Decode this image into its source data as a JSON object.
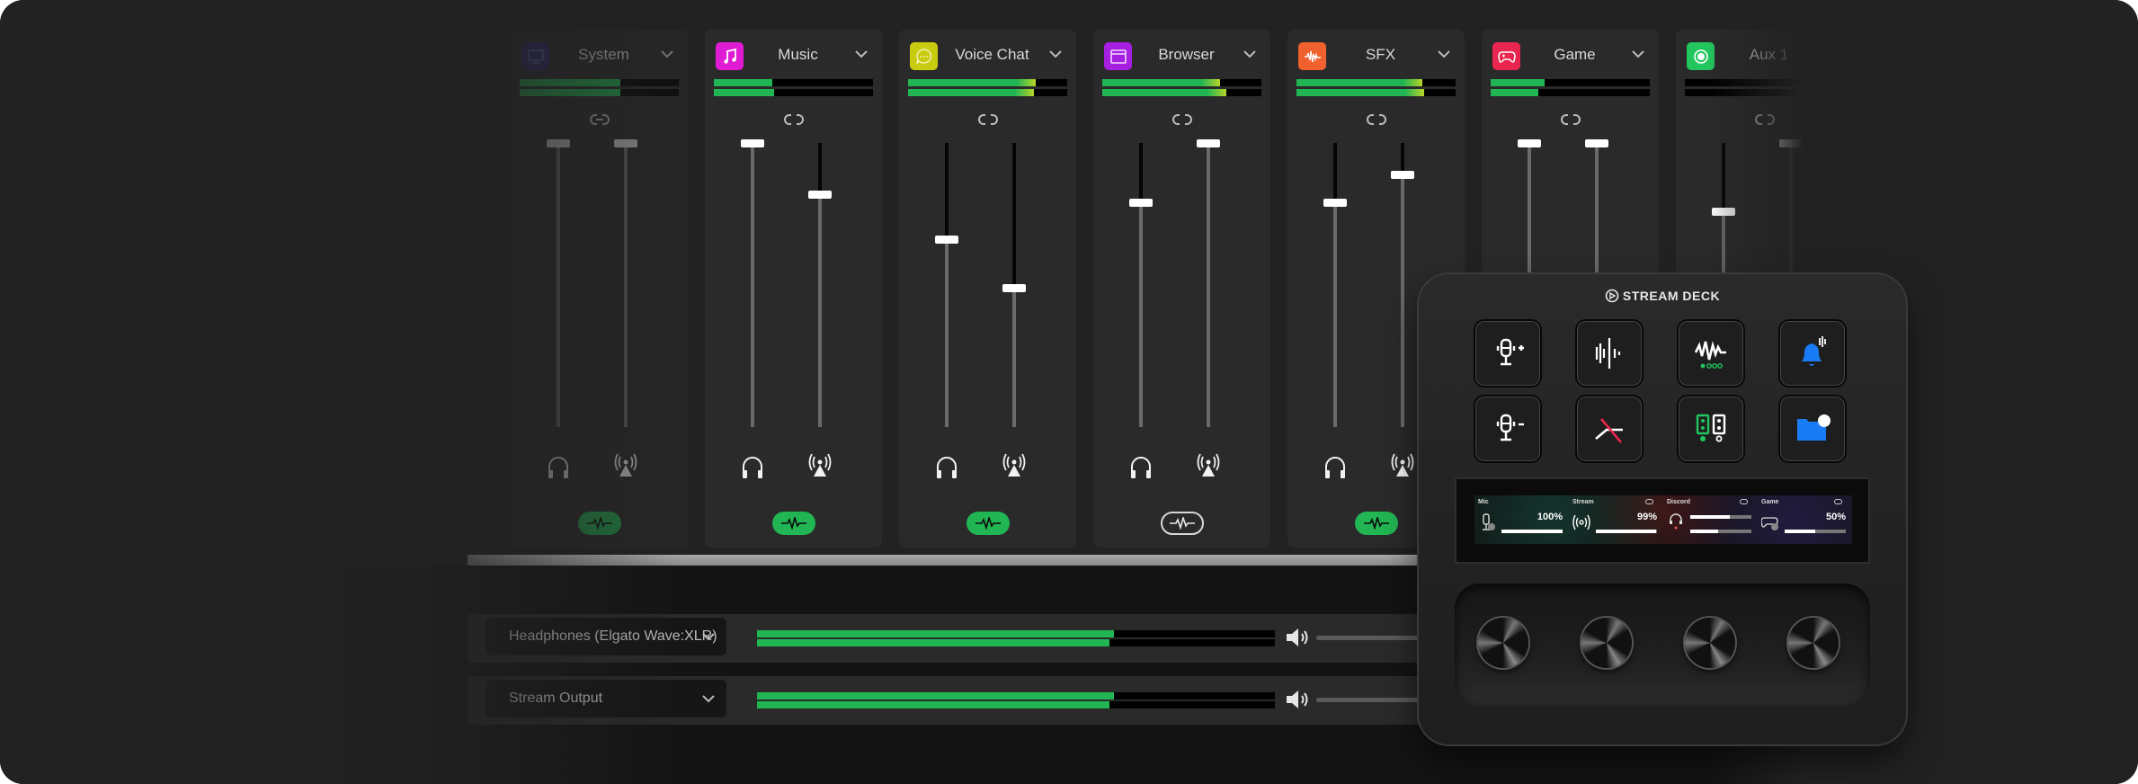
{
  "mixer": {
    "channels": [
      {
        "name": "System",
        "icon": "monitor-icon",
        "color": "#2a2670",
        "meter": [
          0.63,
          0.63
        ],
        "faders": [
          1.0,
          1.0
        ],
        "fx_on": true,
        "dim": true
      },
      {
        "name": "Music",
        "icon": "music-note-icon",
        "color": "#e01bd4",
        "meter": [
          0.37,
          0.38
        ],
        "faders": [
          1.0,
          0.82
        ],
        "fx_on": true
      },
      {
        "name": "Voice Chat",
        "icon": "chat-bubble-icon",
        "color": "#c8cc10",
        "meter": [
          0.8,
          0.79
        ],
        "faders": [
          0.66,
          0.49
        ],
        "fx_on": true
      },
      {
        "name": "Browser",
        "icon": "browser-window-icon",
        "color": "#a61ee0",
        "meter": [
          0.74,
          0.78
        ],
        "faders": [
          0.79,
          1.0
        ],
        "fx_on": false
      },
      {
        "name": "SFX",
        "icon": "waveform-icon",
        "color": "#f0612f",
        "meter": [
          0.79,
          0.8
        ],
        "faders": [
          0.79,
          0.89
        ],
        "fx_on": true
      },
      {
        "name": "Game",
        "icon": "gamepad-icon",
        "color": "#e8264f",
        "meter": [
          0.34,
          0.3
        ],
        "faders": [
          1.0,
          1.0
        ],
        "fx_on": true
      },
      {
        "name": "Aux 1",
        "icon": "record-icon",
        "color": "#22c55e",
        "meter": [
          0.0,
          0.0
        ],
        "faders": [
          0.76,
          1.0
        ],
        "fx_on": true
      }
    ],
    "outputs": [
      {
        "device": "Headphones (Elgato Wave:XLR)",
        "meter": [
          0.69,
          0.68
        ]
      },
      {
        "device": "Stream Output",
        "meter": [
          0.69,
          0.68
        ]
      }
    ]
  },
  "deck": {
    "brand": "STREAM DECK",
    "keys": [
      {
        "name": "mic-volume-up",
        "icon": "mic-plus-icon"
      },
      {
        "name": "voice-wave",
        "icon": "voice-wave-icon"
      },
      {
        "name": "voice-effect-preset",
        "icon": "voice-effect-icon"
      },
      {
        "name": "sound-alert",
        "icon": "bell-sound-icon"
      },
      {
        "name": "mic-volume-down",
        "icon": "mic-minus-icon"
      },
      {
        "name": "monitor-mute",
        "icon": "mute-crossed-icon"
      },
      {
        "name": "output-switch",
        "icon": "speakers-switch-icon"
      },
      {
        "name": "open-folder",
        "icon": "folder-icon"
      }
    ],
    "lcd": [
      {
        "label": "Mic",
        "value": "100%",
        "level": 1.0,
        "toggle": false
      },
      {
        "label": "Stream",
        "value": "99%",
        "level": 0.99,
        "toggle": true
      },
      {
        "label": "Discord",
        "value": "",
        "levels": [
          0.65,
          0.45
        ],
        "toggle": true
      },
      {
        "label": "Game",
        "value": "50%",
        "level": 0.5,
        "toggle": true
      }
    ]
  }
}
